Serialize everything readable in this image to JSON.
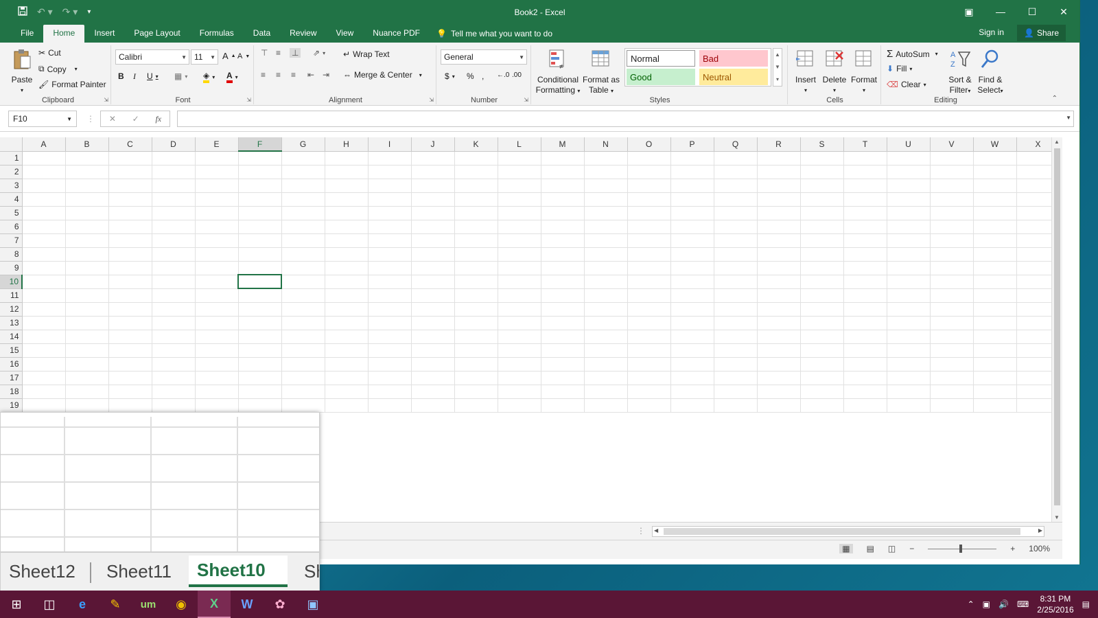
{
  "window": {
    "title": "Book2 - Excel"
  },
  "tabs": [
    "File",
    "Home",
    "Insert",
    "Page Layout",
    "Formulas",
    "Data",
    "Review",
    "View",
    "Nuance PDF"
  ],
  "tell_me": "Tell me what you want to do",
  "sign_in": "Sign in",
  "share": "Share",
  "ribbon": {
    "clipboard": {
      "label": "Clipboard",
      "paste": "Paste",
      "cut": "Cut",
      "copy": "Copy",
      "format_painter": "Format Painter"
    },
    "font": {
      "label": "Font",
      "family": "Calibri",
      "size": "11"
    },
    "alignment": {
      "label": "Alignment",
      "wrap_text": "Wrap Text",
      "merge_center": "Merge & Center"
    },
    "number": {
      "label": "Number",
      "format": "General"
    },
    "styles": {
      "label": "Styles",
      "conditional_formatting_1": "Conditional",
      "conditional_formatting_2": "Formatting",
      "format_as_table_1": "Format as",
      "format_as_table_2": "Table",
      "normal": "Normal",
      "bad": "Bad",
      "good": "Good",
      "neutral": "Neutral"
    },
    "cells": {
      "label": "Cells",
      "insert": "Insert",
      "delete": "Delete",
      "format": "Format"
    },
    "editing": {
      "label": "Editing",
      "autosum": "AutoSum",
      "fill": "Fill",
      "clear": "Clear",
      "sort_filter_1": "Sort &",
      "sort_filter_2": "Filter",
      "find_select_1": "Find &",
      "find_select_2": "Select"
    }
  },
  "formula_bar": {
    "name_box": "F10",
    "fx": "fx",
    "value": ""
  },
  "grid": {
    "columns": [
      "A",
      "B",
      "C",
      "D",
      "E",
      "F",
      "G",
      "H",
      "I",
      "J",
      "K",
      "L",
      "M",
      "N",
      "O",
      "P",
      "Q",
      "R",
      "S",
      "T",
      "U",
      "V",
      "W",
      "X"
    ],
    "rows": [
      "1",
      "2",
      "3",
      "4",
      "5",
      "6",
      "7",
      "8",
      "9",
      "10",
      "11",
      "12",
      "13",
      "14",
      "15",
      "16",
      "17",
      "18",
      "19"
    ],
    "selected_column": "F",
    "selected_row": "10"
  },
  "status": {
    "zoom": "100%"
  },
  "zoom_overlay": {
    "sheet_tabs": [
      "Sheet12",
      "Sheet11",
      "Sheet10",
      "Sh"
    ],
    "active_tab": "Sheet10"
  },
  "taskbar": {
    "time": "8:31 PM",
    "date": "2/25/2016"
  },
  "colors": {
    "accent": "#217346",
    "taskbar": "#5a1636"
  }
}
